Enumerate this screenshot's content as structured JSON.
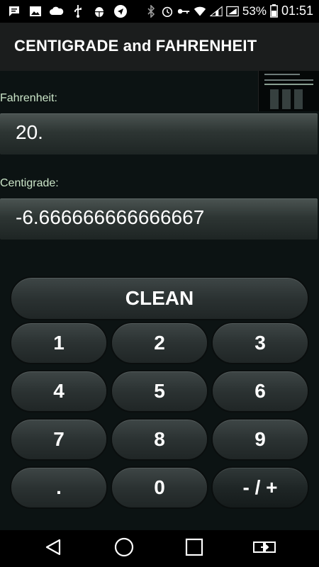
{
  "status_bar": {
    "battery_percent": "53%",
    "time": "01:51",
    "left_icons": [
      "message-icon",
      "gallery-icon",
      "cloud-icon",
      "usb-icon",
      "android-debug-icon",
      "navigation-icon"
    ],
    "right_icons": [
      "bluetooth-icon",
      "alarm-icon",
      "key-icon",
      "wifi-icon",
      "signal-icon",
      "battery-icon"
    ]
  },
  "app": {
    "title": "CENTIGRADE and FAHRENHEIT"
  },
  "fahrenheit": {
    "label": "Fahrenheit:",
    "value": "20."
  },
  "centigrade": {
    "label": "Centigrade:",
    "value": "-6.666666666666667"
  },
  "keypad": {
    "clean": "CLEAN",
    "keys": [
      "1",
      "2",
      "3",
      "4",
      "5",
      "6",
      "7",
      "8",
      "9",
      ".",
      "0",
      "- / +"
    ]
  },
  "nav": {
    "icons": [
      "back-icon",
      "home-icon",
      "recents-icon",
      "switch-apps-icon"
    ]
  },
  "colors": {
    "label_text": "#cbe5c8",
    "background": "#0c1313",
    "action_bar": "#1b1d1d"
  }
}
